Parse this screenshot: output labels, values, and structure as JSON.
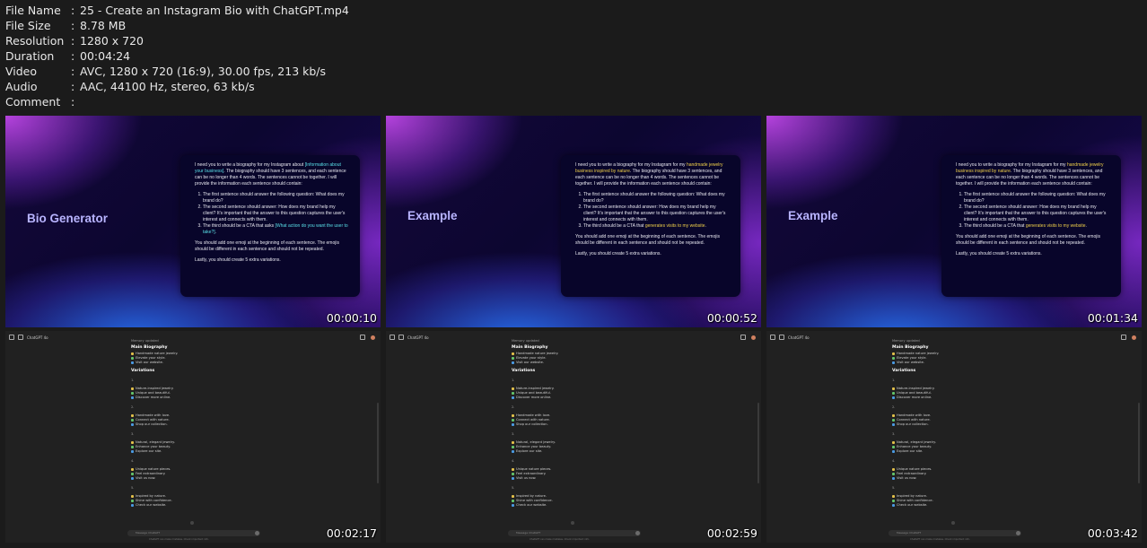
{
  "meta": {
    "file_name_key": "File Name",
    "file_name": "25 - Create an Instagram Bio with ChatGPT.mp4",
    "file_size_key": "File Size",
    "file_size": "8.78 MB",
    "resolution_key": "Resolution",
    "resolution": "1280 x 720",
    "duration_key": "Duration",
    "duration": "00:04:24",
    "video_key": "Video",
    "video": "AVC, 1280 x 720 (16:9), 30.00 fps, 213 kb/s",
    "audio_key": "Audio",
    "audio": "AAC, 44100 Hz, stereo, 63 kb/s",
    "comment_key": "Comment",
    "comment": "",
    "separator": ":"
  },
  "thumbs": [
    {
      "timestamp": "00:00:10",
      "title": "Bio Generator"
    },
    {
      "timestamp": "00:00:52",
      "title": "Example"
    },
    {
      "timestamp": "00:01:34",
      "title": "Example"
    },
    {
      "timestamp": "00:02:17"
    },
    {
      "timestamp": "00:02:59"
    },
    {
      "timestamp": "00:03:42"
    }
  ],
  "slide1": {
    "p1a": "I need you to write a biography for my Instagram about ",
    "p1hl": "[Information about your business]",
    "p1b": ". The biography should have 3 sentences, and each sentence can be no longer than 4 words. The sentences cannot be together. I will provide the information each sentence should contain:",
    "li1": "The first sentence should answer the following question: What does my brand do?",
    "li2": "The second sentence should answer: How does my brand help my client? It's important that the answer to this question captures the user's interest and connects with them.",
    "li3a": "The third should be a CTA that asks ",
    "li3hl": "[What action do you want the user to take?]",
    "li3b": ".",
    "p2": "You should add one emoji at the beginning of each sentence. The emojis should be different in each sentence and should not be repeated.",
    "p3": "Lastly, you should create 5 extra variations."
  },
  "slide2": {
    "p1a": "I need you to write a biography for my Instagram for my ",
    "p1hl": "handmade jewelry business inspired by nature",
    "p1b": ". The biography should have 3 sentences, and each sentence can be no longer than 4 words. The sentences cannot be together. I will provide the information each sentence should contain:",
    "li1": "The first sentence should answer the following question: What does my brand do?",
    "li2": "The second sentence should answer: How does my brand help my client? It's important that the answer to this question captures the user's interest and connects with them.",
    "li3a": "The third should be a CTA that ",
    "li3hl": "generates visits to my website",
    "li3b": ".",
    "p2": "You should add one emoji at the beginning of each sentence. The emojis should be different in each sentence and should not be repeated.",
    "p3": "Lastly, you should create 5 extra variations."
  },
  "chat": {
    "app_name": "ChatGPT 4o",
    "memory": "Memory updated",
    "main_heading": "Main Biography",
    "main_lines": [
      "Handmade nature jewelry.",
      "Elevate your style.",
      "Visit our website."
    ],
    "variations_heading": "Variations",
    "groups": [
      {
        "num": "1.",
        "lines": [
          "Nature-inspired jewelry.",
          "Unique and beautiful.",
          "Discover more online."
        ]
      },
      {
        "num": "2.",
        "lines": [
          "Handmade with love.",
          "Connect with nature.",
          "Shop our collection."
        ]
      },
      {
        "num": "3.",
        "lines": [
          "Natural, elegant jewelry.",
          "Enhance your beauty.",
          "Explore our site."
        ]
      },
      {
        "num": "4.",
        "lines": [
          "Unique nature pieces.",
          "Feel extraordinary.",
          "Visit us now."
        ]
      },
      {
        "num": "5.",
        "lines": [
          "Inspired by nature.",
          "Shine with confidence.",
          "Check our website."
        ]
      }
    ],
    "input_placeholder": "Message ChatGPT",
    "footer": "ChatGPT can make mistakes. Check important info."
  },
  "colors": {
    "accent_cyan": "#59e0e8",
    "accent_yellow": "#f0d04a",
    "slide_title": "#b8b4ff"
  }
}
